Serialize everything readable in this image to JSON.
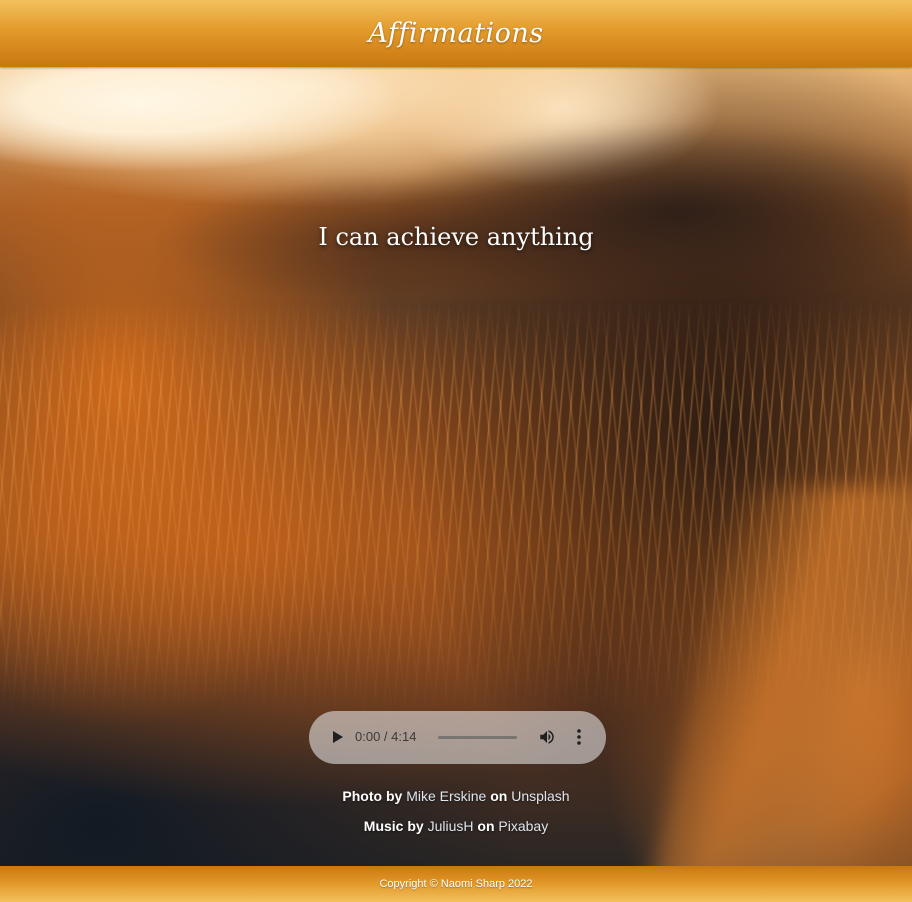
{
  "header": {
    "title": "Affirmations"
  },
  "hero": {
    "affirmation": "I can achieve anything"
  },
  "audio": {
    "time_display": "0:00 / 4:14",
    "progress": 0,
    "play_icon": "play-icon",
    "volume_icon": "volume-icon",
    "menu_icon": "more-vertical-icon"
  },
  "credits": {
    "photo": {
      "prefix": "Photo by ",
      "author": "Mike Erskine",
      "joiner": " on ",
      "source": "Unsplash"
    },
    "music": {
      "prefix": "Music by ",
      "author": "JuliusH",
      "joiner": " on ",
      "source": "Pixabay"
    }
  },
  "footer": {
    "copyright": "Copyright © Naomi Sharp 2022"
  },
  "colors": {
    "header_gradient_top": "#f2c15d",
    "header_gradient_bottom": "#c9770f",
    "link_color": "#dfe6ef"
  }
}
